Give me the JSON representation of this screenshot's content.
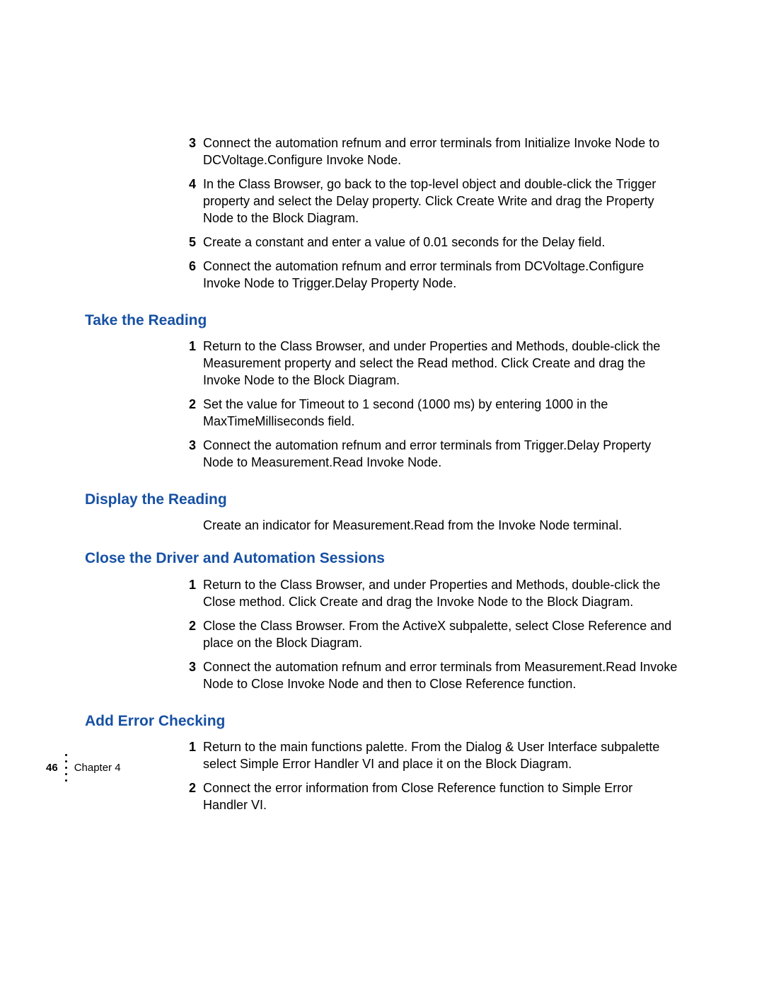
{
  "intro_list": [
    {
      "n": "3",
      "text": "Connect the automation refnum and error terminals from Initialize Invoke Node to DCVoltage.Configure Invoke Node."
    },
    {
      "n": "4",
      "text": "In the Class Browser, go back to the top-level object and double-click the Trigger property and select the Delay property. Click Create Write and drag the Property Node to the Block Diagram."
    },
    {
      "n": "5",
      "text": "Create a constant and enter a value of 0.01 seconds for the Delay field."
    },
    {
      "n": "6",
      "text": "Connect the automation refnum and error terminals from DCVoltage.Configure Invoke Node to Trigger.Delay Property Node."
    }
  ],
  "sections": {
    "take_reading": {
      "heading": "Take the Reading",
      "items": [
        {
          "n": "1",
          "text": "Return to the Class Browser, and under Properties and Methods, double-click the Measurement property and select the Read method. Click Create and drag the Invoke Node to the Block Diagram."
        },
        {
          "n": "2",
          "text": "Set the value for Timeout to 1 second (1000 ms) by entering 1000 in the MaxTimeMilliseconds field."
        },
        {
          "n": "3",
          "text": "Connect the automation refnum and error terminals from Trigger.Delay Property Node to Measurement.Read Invoke Node."
        }
      ]
    },
    "display_reading": {
      "heading": "Display the Reading",
      "para": "Create an indicator for Measurement.Read from the Invoke Node terminal."
    },
    "close_driver": {
      "heading": "Close the Driver and Automation Sessions",
      "items": [
        {
          "n": "1",
          "text": "Return to the Class Browser, and under Properties and Methods, double-click the Close method. Click Create and drag the Invoke Node to the Block Diagram."
        },
        {
          "n": "2",
          "text": "Close the Class Browser. From the ActiveX subpalette, select Close Reference and place on the Block Diagram."
        },
        {
          "n": "3",
          "text": "Connect the automation refnum and error terminals from Measurement.Read Invoke Node to Close Invoke Node and then to Close Reference function."
        }
      ]
    },
    "add_error": {
      "heading": "Add Error Checking",
      "items": [
        {
          "n": "1",
          "text": "Return to the main functions palette. From the Dialog & User Interface subpalette select Simple Error Handler VI and place it on the Block Diagram."
        },
        {
          "n": "2",
          "text": "Connect the error information from Close Reference function to Simple Error Handler VI."
        }
      ]
    }
  },
  "footer": {
    "page_number": "46",
    "chapter": "Chapter 4"
  }
}
